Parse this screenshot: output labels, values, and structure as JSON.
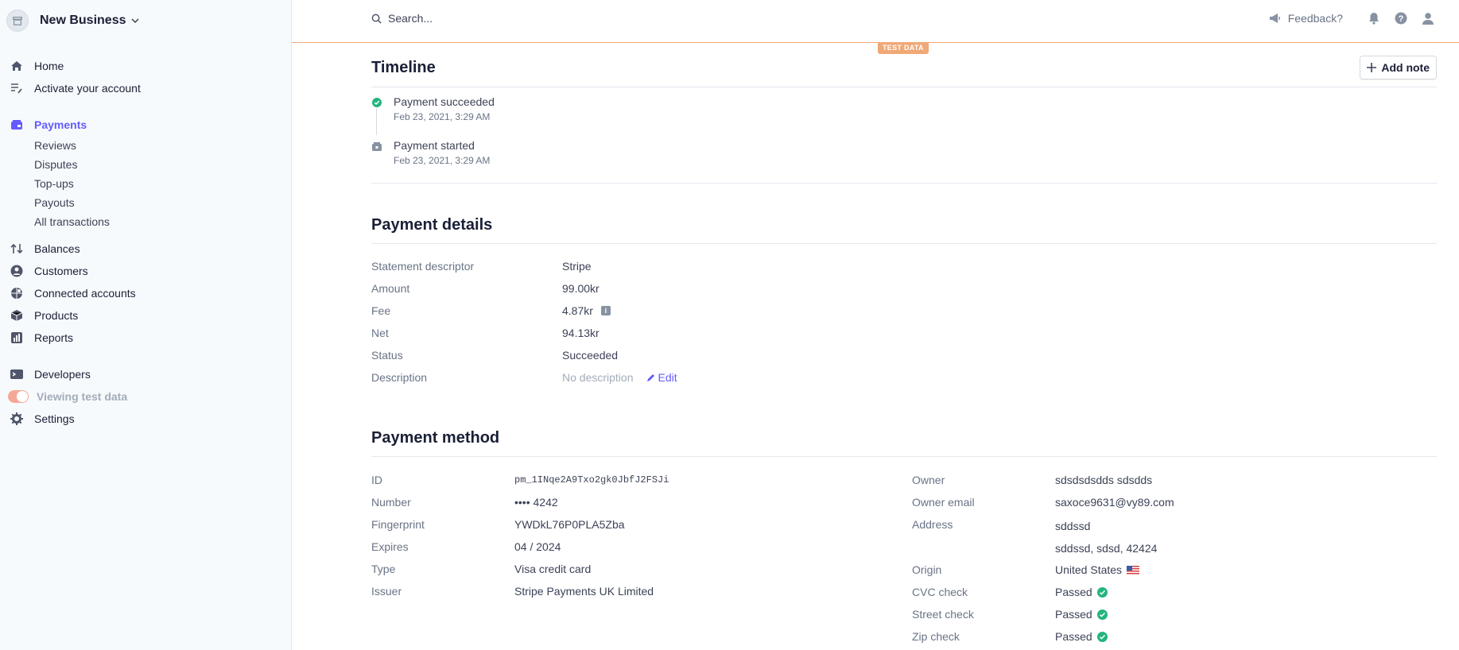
{
  "account": {
    "name": "New Business"
  },
  "sidebar": {
    "home": "Home",
    "activate": "Activate your account",
    "payments": "Payments",
    "payments_sub": [
      "Reviews",
      "Disputes",
      "Top-ups",
      "Payouts",
      "All transactions"
    ],
    "balances": "Balances",
    "customers": "Customers",
    "connected": "Connected accounts",
    "products": "Products",
    "reports": "Reports",
    "developers": "Developers",
    "test_data": "Viewing test data",
    "settings": "Settings"
  },
  "topbar": {
    "search_placeholder": "Search...",
    "feedback": "Feedback?",
    "test_badge": "TEST DATA"
  },
  "timeline": {
    "title": "Timeline",
    "add_note": "Add note",
    "events": [
      {
        "title": "Payment succeeded",
        "date": "Feb 23, 2021, 3:29 AM",
        "status_color": "#24b47e"
      },
      {
        "title": "Payment started",
        "date": "Feb 23, 2021, 3:29 AM",
        "status_color": "#8792a2"
      }
    ]
  },
  "payment_details": {
    "title": "Payment details",
    "rows": {
      "statement_descriptor": {
        "label": "Statement descriptor",
        "value": "Stripe"
      },
      "amount": {
        "label": "Amount",
        "value": "99.00kr"
      },
      "fee": {
        "label": "Fee",
        "value": "4.87kr"
      },
      "net": {
        "label": "Net",
        "value": "94.13kr"
      },
      "status": {
        "label": "Status",
        "value": "Succeeded"
      },
      "description": {
        "label": "Description",
        "value": "No description",
        "edit": "Edit"
      }
    }
  },
  "payment_method": {
    "title": "Payment method",
    "left": {
      "id": {
        "label": "ID",
        "value": "pm_1INqe2A9Txo2gk0JbfJ2FSJi"
      },
      "number": {
        "label": "Number",
        "value": "•••• 4242"
      },
      "fingerprint": {
        "label": "Fingerprint",
        "value": "YWDkL76P0PLA5Zba"
      },
      "expires": {
        "label": "Expires",
        "value": "04 / 2024"
      },
      "type": {
        "label": "Type",
        "value": "Visa credit card"
      },
      "issuer": {
        "label": "Issuer",
        "value": "Stripe Payments UK Limited"
      }
    },
    "right": {
      "owner": {
        "label": "Owner",
        "value": "sdsdsdsdds sdsdds"
      },
      "owner_email": {
        "label": "Owner email",
        "value": "saxoce9631@vy89.com"
      },
      "address": {
        "label": "Address",
        "line1": "sddssd",
        "line2": "sddssd, sdsd, 42424"
      },
      "origin": {
        "label": "Origin",
        "value": "United States"
      },
      "cvc_check": {
        "label": "CVC check",
        "value": "Passed"
      },
      "street_check": {
        "label": "Street check",
        "value": "Passed"
      },
      "zip_check": {
        "label": "Zip check",
        "value": "Passed"
      }
    }
  },
  "colors": {
    "accent": "#635bff",
    "success": "#24b47e",
    "test_orange": "#f0a877"
  }
}
